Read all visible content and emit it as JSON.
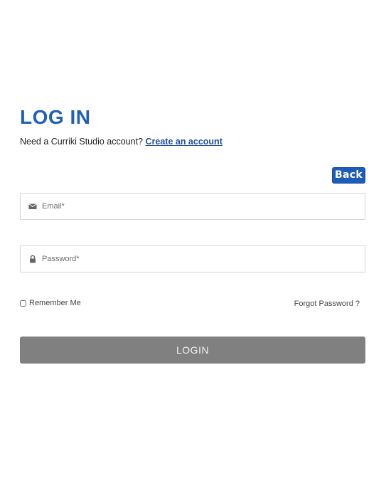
{
  "header": {
    "title": "LOG IN",
    "subtitle_prefix": "Need a Curriki Studio account? ",
    "create_account_link": "Create an account"
  },
  "actions": {
    "back_label": "Back",
    "login_label": "LOGIN"
  },
  "form": {
    "email": {
      "placeholder": "Email*",
      "value": "",
      "icon": "envelope-icon"
    },
    "password": {
      "placeholder": "Password*",
      "value": "",
      "icon": "lock-icon"
    },
    "remember_label": "Remember Me",
    "remember_checked": false,
    "forgot_label": "Forgot Password ?"
  },
  "colors": {
    "title": "#2160b8",
    "link": "#1f4f9e",
    "back_button": "#1d5cb8",
    "login_button": "#808080"
  }
}
